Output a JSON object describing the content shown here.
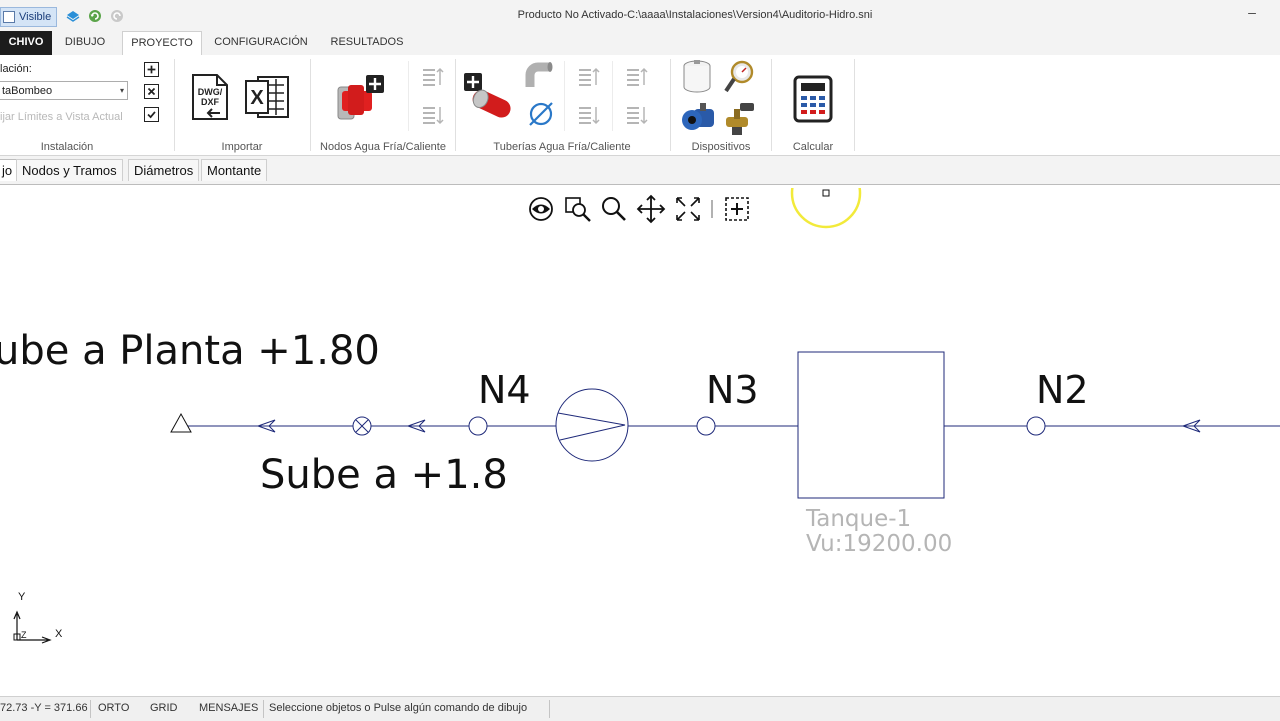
{
  "window": {
    "title": "Producto No Activado-C:\\aaaa\\Instalaciones\\Version4\\Auditorio-Hidro.sni",
    "quick_access_visible_label": "Visible",
    "minimize_glyph": "–"
  },
  "ribbon_tabs": [
    "CHIVO",
    "DIBUJO",
    "PROYECTO",
    "CONFIGURACIÓN",
    "RESULTADOS"
  ],
  "active_tab": "PROYECTO",
  "ribbon": {
    "instalacion": {
      "label": "lación:",
      "selected": "taBombeo",
      "fix_limits": "ijar Límites a Vista Actual",
      "group_label": "Instalación"
    },
    "importar": {
      "group_label": "Importar",
      "dwg_text": "DWG/DXF",
      "excel_text": "X"
    },
    "nodos": {
      "group_label": "Nodos Agua Fría/Caliente"
    },
    "tuberias": {
      "group_label": "Tuberías Agua Fría/Caliente"
    },
    "dispositivos": {
      "group_label": "Dispositivos"
    },
    "calcular": {
      "group_label": "Calcular"
    }
  },
  "sub_tabs": [
    "jo",
    "Nodos y Tramos",
    "Diámetros",
    "Montante"
  ],
  "drawing": {
    "text_planta": "ube a Planta +1.80",
    "text_sube": "Sube a +1.8",
    "nodes": [
      "N4",
      "N3",
      "N2"
    ],
    "tank_name": "Tanque-1",
    "tank_volume": "Vu:19200.00",
    "axis_y": "Y",
    "axis_x": "X",
    "axis_z": "Z"
  },
  "status": {
    "coords": "72.73 -Y = 371.66",
    "orto": "ORTO",
    "grid": "GRID",
    "mensajes": "MENSAJES",
    "message": "Seleccione objetos o Pulse algún comando de dibujo"
  },
  "colors": {
    "line": "#1f2a7a",
    "tank_text": "#b5b5b5",
    "highlight": "#f2ea3a",
    "pipe_red": "#e02020"
  }
}
